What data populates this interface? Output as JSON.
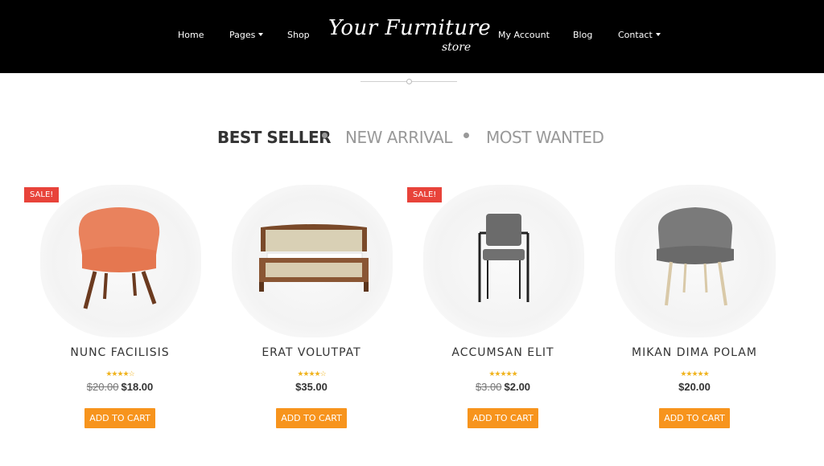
{
  "nav": {
    "left": [
      {
        "label": "Home",
        "dropdown": false
      },
      {
        "label": "Pages",
        "dropdown": true
      },
      {
        "label": "Shop",
        "dropdown": false
      }
    ],
    "right": [
      {
        "label": "My Account",
        "dropdown": false
      },
      {
        "label": "Blog",
        "dropdown": false
      },
      {
        "label": "Contact",
        "dropdown": true
      }
    ],
    "logo_main": "Your Furniture",
    "logo_sub": "store"
  },
  "tabs": {
    "best_seller": "BEST SELLER",
    "new_arrival": "NEW ARRIVAL",
    "most_wanted": "MOST WANTED",
    "active": "best_seller"
  },
  "products": [
    {
      "name": "NUNC FACILISIS",
      "sale_badge": "SALE!",
      "rating": "★★★★☆",
      "old_price": "$20.00",
      "price": "$18.00",
      "cta": "ADD TO CART",
      "image": "orange-armchair"
    },
    {
      "name": "ERAT VOLUTPAT",
      "sale_badge": "",
      "rating": "★★★★☆",
      "old_price": "",
      "price": "$35.00",
      "cta": "ADD TO CART",
      "image": "wooden-bed"
    },
    {
      "name": "ACCUMSAN ELIT",
      "sale_badge": "SALE!",
      "rating": "★★★★★",
      "old_price": "$3.00",
      "price": "$2.00",
      "cta": "ADD TO CART",
      "image": "grey-metal-chair"
    },
    {
      "name": "MIKAN DIMA POLAM",
      "sale_badge": "",
      "rating": "★★★★★",
      "old_price": "",
      "price": "$20.00",
      "cta": "ADD TO CART",
      "image": "grey-shell-chair"
    }
  ],
  "colors": {
    "header_bg": "#000000",
    "accent": "#f7941d",
    "sale": "#e8433a",
    "star": "#f0b31e"
  }
}
